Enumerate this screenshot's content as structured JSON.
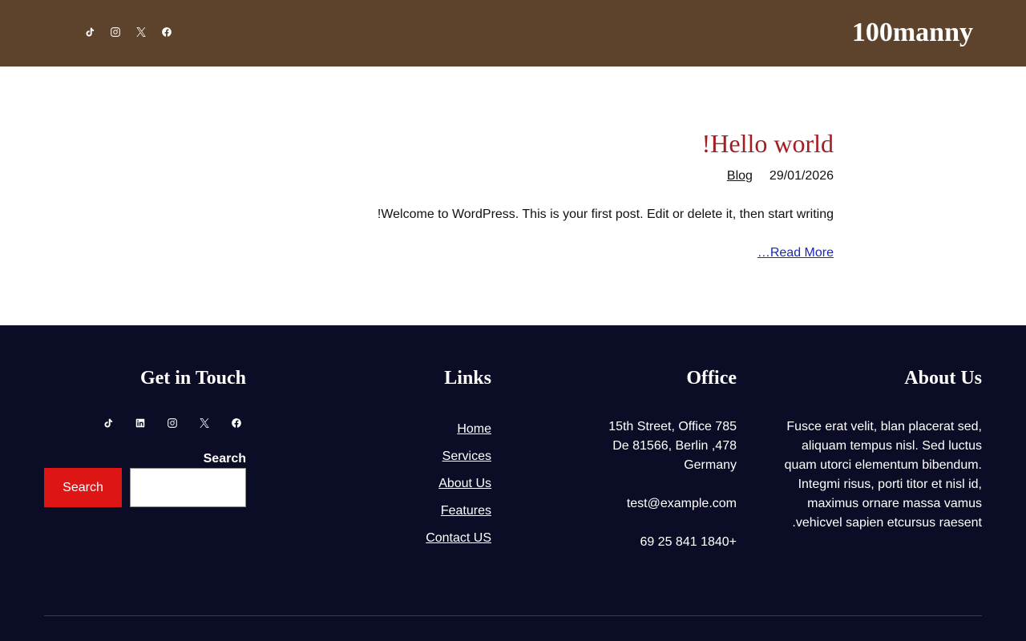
{
  "header": {
    "site_title": "100manny",
    "social_icons": [
      "tiktok-icon",
      "instagram-icon",
      "x-icon",
      "facebook-icon"
    ]
  },
  "post": {
    "title": "!Hello world",
    "category": "Blog",
    "date": "29/01/2026",
    "excerpt": "!Welcome to WordPress. This is your first post. Edit or delete it, then start writing",
    "read_more": "…Read More"
  },
  "footer": {
    "contact": {
      "heading": "Get in Touch",
      "social_icons": [
        "tiktok-icon",
        "linkedin-icon",
        "instagram-icon",
        "x-icon",
        "facebook-icon"
      ],
      "search_label": "Search",
      "search_button": "Search",
      "search_value": ""
    },
    "links": {
      "heading": "Links",
      "items": [
        "Home",
        "Services",
        "About Us",
        "Features",
        "Contact US"
      ]
    },
    "office": {
      "heading": "Office",
      "address_line1": "15th Street, Office 785",
      "address_line2": "De 81566, Berlin ,478",
      "address_line3": "Germany",
      "email": "test@example.com",
      "phone": "69 25 841 1840+"
    },
    "about": {
      "heading": "About Us",
      "text": "Fusce erat velit, blan placerat sed, aliquam tempus nisl. Sed luctus quam utorci elementum bibendum. Integmi risus, porti titor et nisl id, maximus ornare massa vamus .vehicvel sapien etcursus raesent"
    }
  },
  "colors": {
    "header_bg": "#5e432c",
    "footer_bg": "#0b0c25",
    "title_red": "#a31e22",
    "search_button_red": "#dd1515",
    "link_blue": "#1a28b8"
  }
}
